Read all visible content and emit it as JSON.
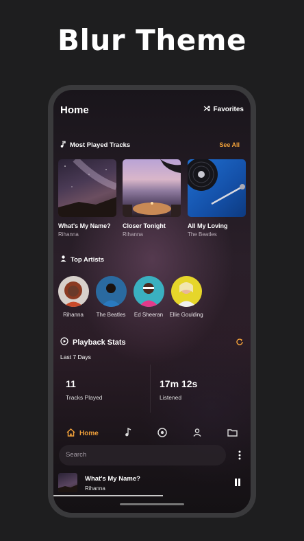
{
  "headline": "Blur Theme",
  "header": {
    "title": "Home",
    "favorites_label": "Favorites"
  },
  "most_played": {
    "heading": "Most Played Tracks",
    "see_all": "See All",
    "tracks": [
      {
        "title": "What's My Name?",
        "artist": "Rihanna"
      },
      {
        "title": "Closer Tonight",
        "artist": "Rihanna"
      },
      {
        "title": "All My Loving",
        "artist": "The Beatles"
      }
    ]
  },
  "top_artists": {
    "heading": "Top Artists",
    "artists": [
      {
        "name": "Rihanna"
      },
      {
        "name": "The Beatles"
      },
      {
        "name": "Ed Sheeran"
      },
      {
        "name": "Ellie Goulding"
      }
    ]
  },
  "playback_stats": {
    "heading": "Playback Stats",
    "period": "Last 7 Days",
    "stats": [
      {
        "value": "11",
        "label": "Tracks Played"
      },
      {
        "value": "17m 12s",
        "label": "Listened"
      }
    ]
  },
  "nav": {
    "home_label": "Home",
    "icons": [
      "home-icon",
      "music-note-icon",
      "disc-icon",
      "person-icon",
      "folder-icon"
    ]
  },
  "search": {
    "placeholder": "Search"
  },
  "now_playing": {
    "title": "What's My Name?",
    "artist": "Rihanna"
  },
  "colors": {
    "accent": "#f0a03a",
    "background": "#1e1e1f"
  }
}
